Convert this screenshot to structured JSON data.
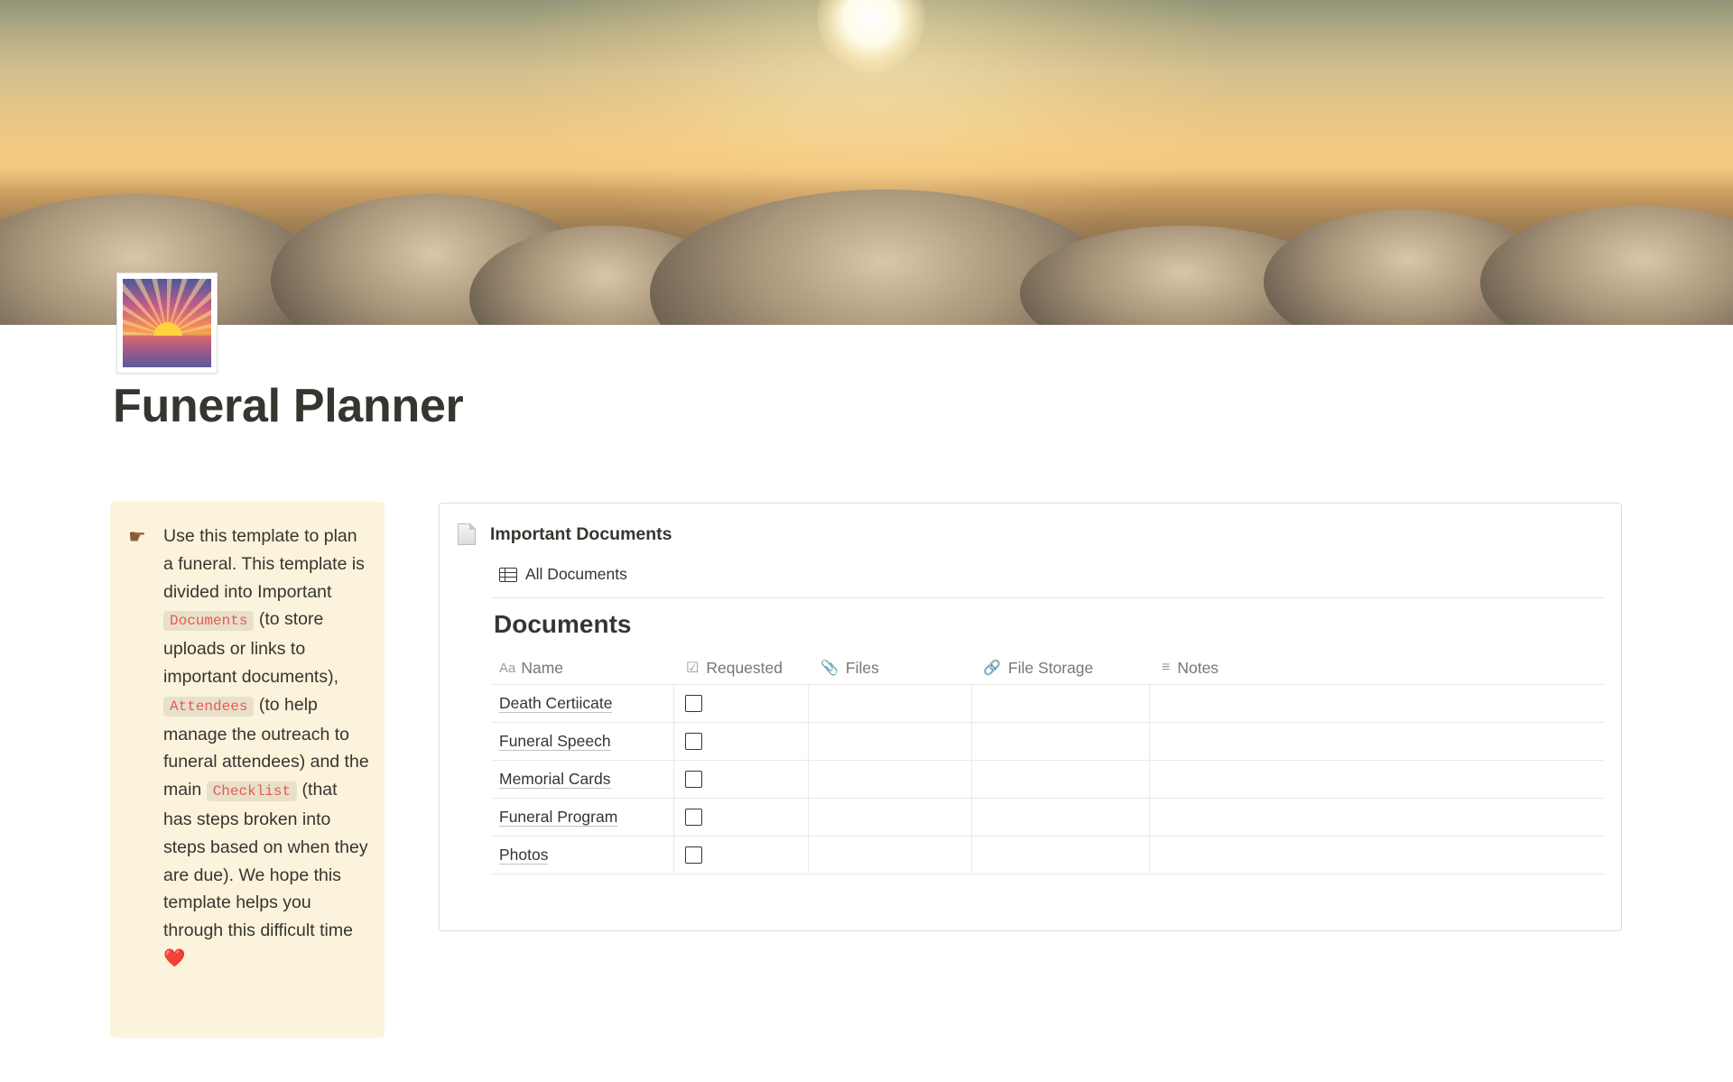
{
  "page": {
    "title": "Funeral Planner",
    "icon": "sunrise-emoji",
    "cover": "sun-over-clouds"
  },
  "callout": {
    "icon": "pointing-hand-icon",
    "text_1": "Use this template to plan a funeral. This template is divided into Important ",
    "code_1": "Documents",
    "text_2": " (to store uploads or links to important documents), ",
    "code_2": "Attendees",
    "text_3": " (to help manage the outreach to funeral attendees) and the main ",
    "code_3": "Checklist",
    "text_4": " (that has steps broken into steps based on when they are due). We hope this template helps you through this difficult time ",
    "emoji": "❤️"
  },
  "database": {
    "title": "Important Documents",
    "view_tab": "All Documents",
    "heading": "Documents",
    "columns": [
      {
        "label": "Name",
        "icon": "Aa"
      },
      {
        "label": "Requested",
        "icon": "checkbox-icon"
      },
      {
        "label": "Files",
        "icon": "paperclip-icon"
      },
      {
        "label": "File Storage",
        "icon": "link-icon"
      },
      {
        "label": "Notes",
        "icon": "text-lines-icon"
      }
    ],
    "rows": [
      {
        "name": "Death Certiicate",
        "requested": false,
        "files": "",
        "file_storage": "",
        "notes": ""
      },
      {
        "name": "Funeral Speech",
        "requested": false,
        "files": "",
        "file_storage": "",
        "notes": ""
      },
      {
        "name": "Memorial Cards",
        "requested": false,
        "files": "",
        "file_storage": "",
        "notes": ""
      },
      {
        "name": "Funeral Program",
        "requested": false,
        "files": "",
        "file_storage": "",
        "notes": ""
      },
      {
        "name": "Photos",
        "requested": false,
        "files": "",
        "file_storage": "",
        "notes": ""
      }
    ]
  }
}
